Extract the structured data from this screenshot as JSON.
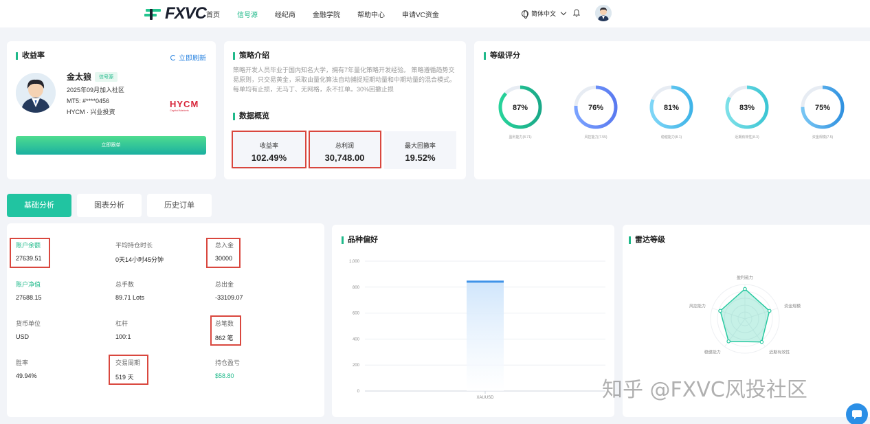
{
  "header": {
    "logo_text": "FXVC",
    "nav": [
      {
        "label": "首页",
        "active": false
      },
      {
        "label": "信号源",
        "active": true
      },
      {
        "label": "经纪商",
        "active": false
      },
      {
        "label": "金融学院",
        "active": false
      },
      {
        "label": "帮助中心",
        "active": false
      },
      {
        "label": "申请VC资金",
        "active": false
      }
    ],
    "language": "简体中文"
  },
  "profit_card": {
    "title": "收益率",
    "refresh": "立即刷新",
    "name": "金太狼",
    "badge": "信号源",
    "joined": "2025年09月加入社区",
    "mt5": "MT5: #****0456",
    "broker": "HYCM · 兴业投资",
    "broker_logo": "HYCM",
    "broker_logo_sub": "Capital Markets",
    "follow_button": "立即跟单"
  },
  "strategy_card": {
    "title": "策略介绍",
    "description": "策略开发人员毕业于国内知名大学，拥有7年量化策略开发经验。 策略遵循趋势交易原则，只交易黄金，采取由量化算法自动捕捉短期动量和中期动量的混合模式。 每单均有止损，无马丁、无网格，永不扛单。30%回撤止损",
    "overview_title": "数据概览",
    "stats": [
      {
        "label": "收益率",
        "value": "102.49%"
      },
      {
        "label": "总利润",
        "value": "30,748.00"
      },
      {
        "label": "最大回撤率",
        "value": "19.52%"
      }
    ]
  },
  "grade_card": {
    "title": "等级评分",
    "items": [
      {
        "percent": "87%",
        "fraction": 0.87,
        "label": "盈利能力(8.71)",
        "color_from": "#27d39a",
        "color_to": "#1aa988"
      },
      {
        "percent": "76%",
        "fraction": 0.76,
        "label": "风控能力(7.55)",
        "color_from": "#7aa2ff",
        "color_to": "#5a7af0"
      },
      {
        "percent": "81%",
        "fraction": 0.81,
        "label": "稳健能力(8.1)",
        "color_from": "#7fd6f7",
        "color_to": "#3fb4e8"
      },
      {
        "percent": "83%",
        "fraction": 0.83,
        "label": "近期有效性(8.3)",
        "color_from": "#7de0e8",
        "color_to": "#3cc6d4"
      },
      {
        "percent": "75%",
        "fraction": 0.75,
        "label": "资金规模(7.5)",
        "color_from": "#78c6f4",
        "color_to": "#3192e0"
      }
    ]
  },
  "tabs": [
    {
      "label": "基础分析",
      "active": true
    },
    {
      "label": "图表分析",
      "active": false
    },
    {
      "label": "历史订单",
      "active": false
    }
  ],
  "basic": {
    "cells": [
      {
        "label": "账户余额",
        "value": "27639.51",
        "label_green": true
      },
      {
        "label": "平均持仓时长",
        "value": "0天14小时45分钟"
      },
      {
        "label": "总入金",
        "value": "30000"
      },
      {
        "label": "账户净值",
        "value": "27688.15",
        "label_green": true
      },
      {
        "label": "总手数",
        "value": "89.71 Lots"
      },
      {
        "label": "总出金",
        "value": "-33109.07"
      },
      {
        "label": "货币单位",
        "value": "USD"
      },
      {
        "label": "杠杆",
        "value": "100:1"
      },
      {
        "label": "总笔数",
        "value": "862 笔"
      },
      {
        "label": "胜率",
        "value": "49.94%"
      },
      {
        "label": "交易周期",
        "value": "519 天"
      },
      {
        "label": "持仓盈亏",
        "value": "$58.80",
        "value_green": true
      }
    ]
  },
  "variety_card": {
    "title": "品种偏好"
  },
  "radar_card": {
    "title": "雷达等级"
  },
  "chart_data": [
    {
      "type": "bar",
      "categories": [
        "XAUUSD"
      ],
      "values": [
        850
      ],
      "ylim": [
        0,
        1000
      ],
      "yticks": [
        "0",
        "200",
        "400",
        "600",
        "800",
        "1,000"
      ],
      "grid": true,
      "color": "#3f93e8"
    },
    {
      "type": "radar",
      "categories": [
        "盈利能力",
        "资金规模",
        "近期有效性",
        "稳健能力",
        "风控能力"
      ],
      "values": [
        8.71,
        7.5,
        8.3,
        8.1,
        7.55
      ],
      "ylim": [
        0,
        10
      ],
      "color": "#27c9a0"
    }
  ],
  "watermark": "知乎 @FXVC风投社区"
}
